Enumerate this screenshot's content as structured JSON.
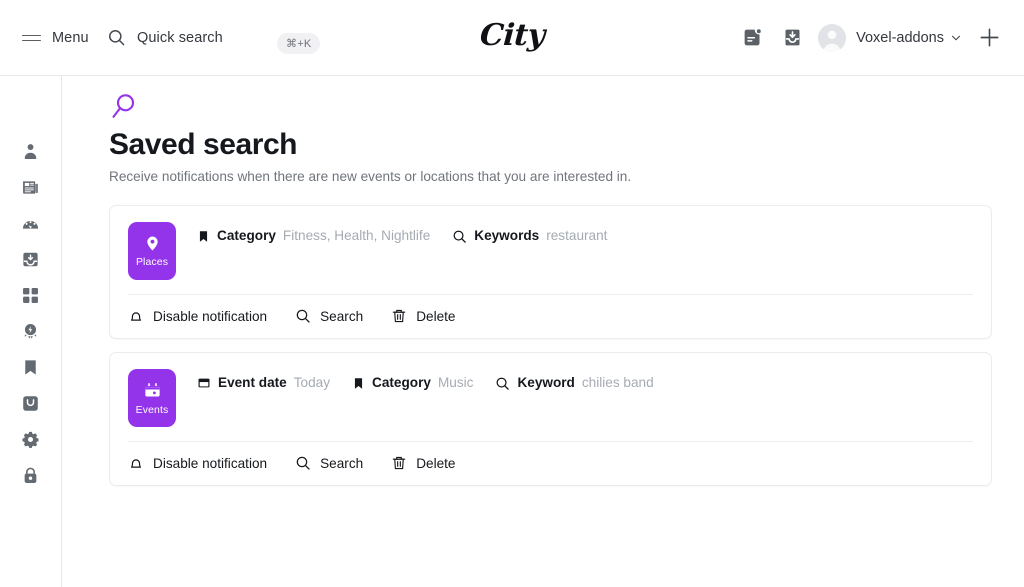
{
  "topbar": {
    "menu_label": "Menu",
    "quick_search_label": "Quick search",
    "shortcut": "⌘+K",
    "brand": "City",
    "user_name": "Voxel-addons",
    "icons": {
      "menu": "hamburger-icon",
      "search": "search-icon",
      "notifications": "notification-card-icon",
      "inbox": "inbox-download-icon",
      "avatar": "avatar-icon",
      "chevron": "chevron-down-icon",
      "plus": "plus-icon"
    }
  },
  "sidebar": {
    "items": [
      {
        "name": "profile",
        "icon": "person-icon"
      },
      {
        "name": "news",
        "icon": "newspaper-icon"
      },
      {
        "name": "dashboard",
        "icon": "gauge-icon"
      },
      {
        "name": "inbox",
        "icon": "inbox-icon"
      },
      {
        "name": "apps",
        "icon": "grid-icon"
      },
      {
        "name": "promotion",
        "icon": "award-bolt-icon"
      },
      {
        "name": "saved",
        "icon": "bookmark-icon"
      },
      {
        "name": "orders",
        "icon": "bag-icon"
      },
      {
        "name": "settings",
        "icon": "gear-icon"
      },
      {
        "name": "security",
        "icon": "lock-icon"
      }
    ]
  },
  "page": {
    "icon": "search-magnifier-icon",
    "title": "Saved search",
    "subtitle": "Receive notifications when there are new events or locations that you are interested in."
  },
  "theme": {
    "accent": "#9333ea",
    "text": "#15181c",
    "muted": "#a6abb2",
    "border": "#ececed"
  },
  "cards": [
    {
      "badge": {
        "label": "Places",
        "icon": "map-pin-icon",
        "color": "#9333ea"
      },
      "filters": [
        {
          "icon": "bookmark-icon",
          "label": "Category",
          "value": "Fitness, Health, Nightlife"
        },
        {
          "icon": "search-icon",
          "label": "Keywords",
          "value": "restaurant"
        }
      ],
      "actions": [
        {
          "icon": "bell-icon",
          "label": "Disable notification"
        },
        {
          "icon": "search-icon",
          "label": "Search"
        },
        {
          "icon": "trash-icon",
          "label": "Delete"
        }
      ]
    },
    {
      "badge": {
        "label": "Events",
        "icon": "calendar-icon",
        "color": "#9333ea"
      },
      "filters": [
        {
          "icon": "calendar-icon",
          "label": "Event date",
          "value": "Today"
        },
        {
          "icon": "bookmark-icon",
          "label": "Category",
          "value": "Music"
        },
        {
          "icon": "search-icon",
          "label": "Keyword",
          "value": "chilies band"
        }
      ],
      "actions": [
        {
          "icon": "bell-icon",
          "label": "Disable notification"
        },
        {
          "icon": "search-icon",
          "label": "Search"
        },
        {
          "icon": "trash-icon",
          "label": "Delete"
        }
      ]
    }
  ]
}
